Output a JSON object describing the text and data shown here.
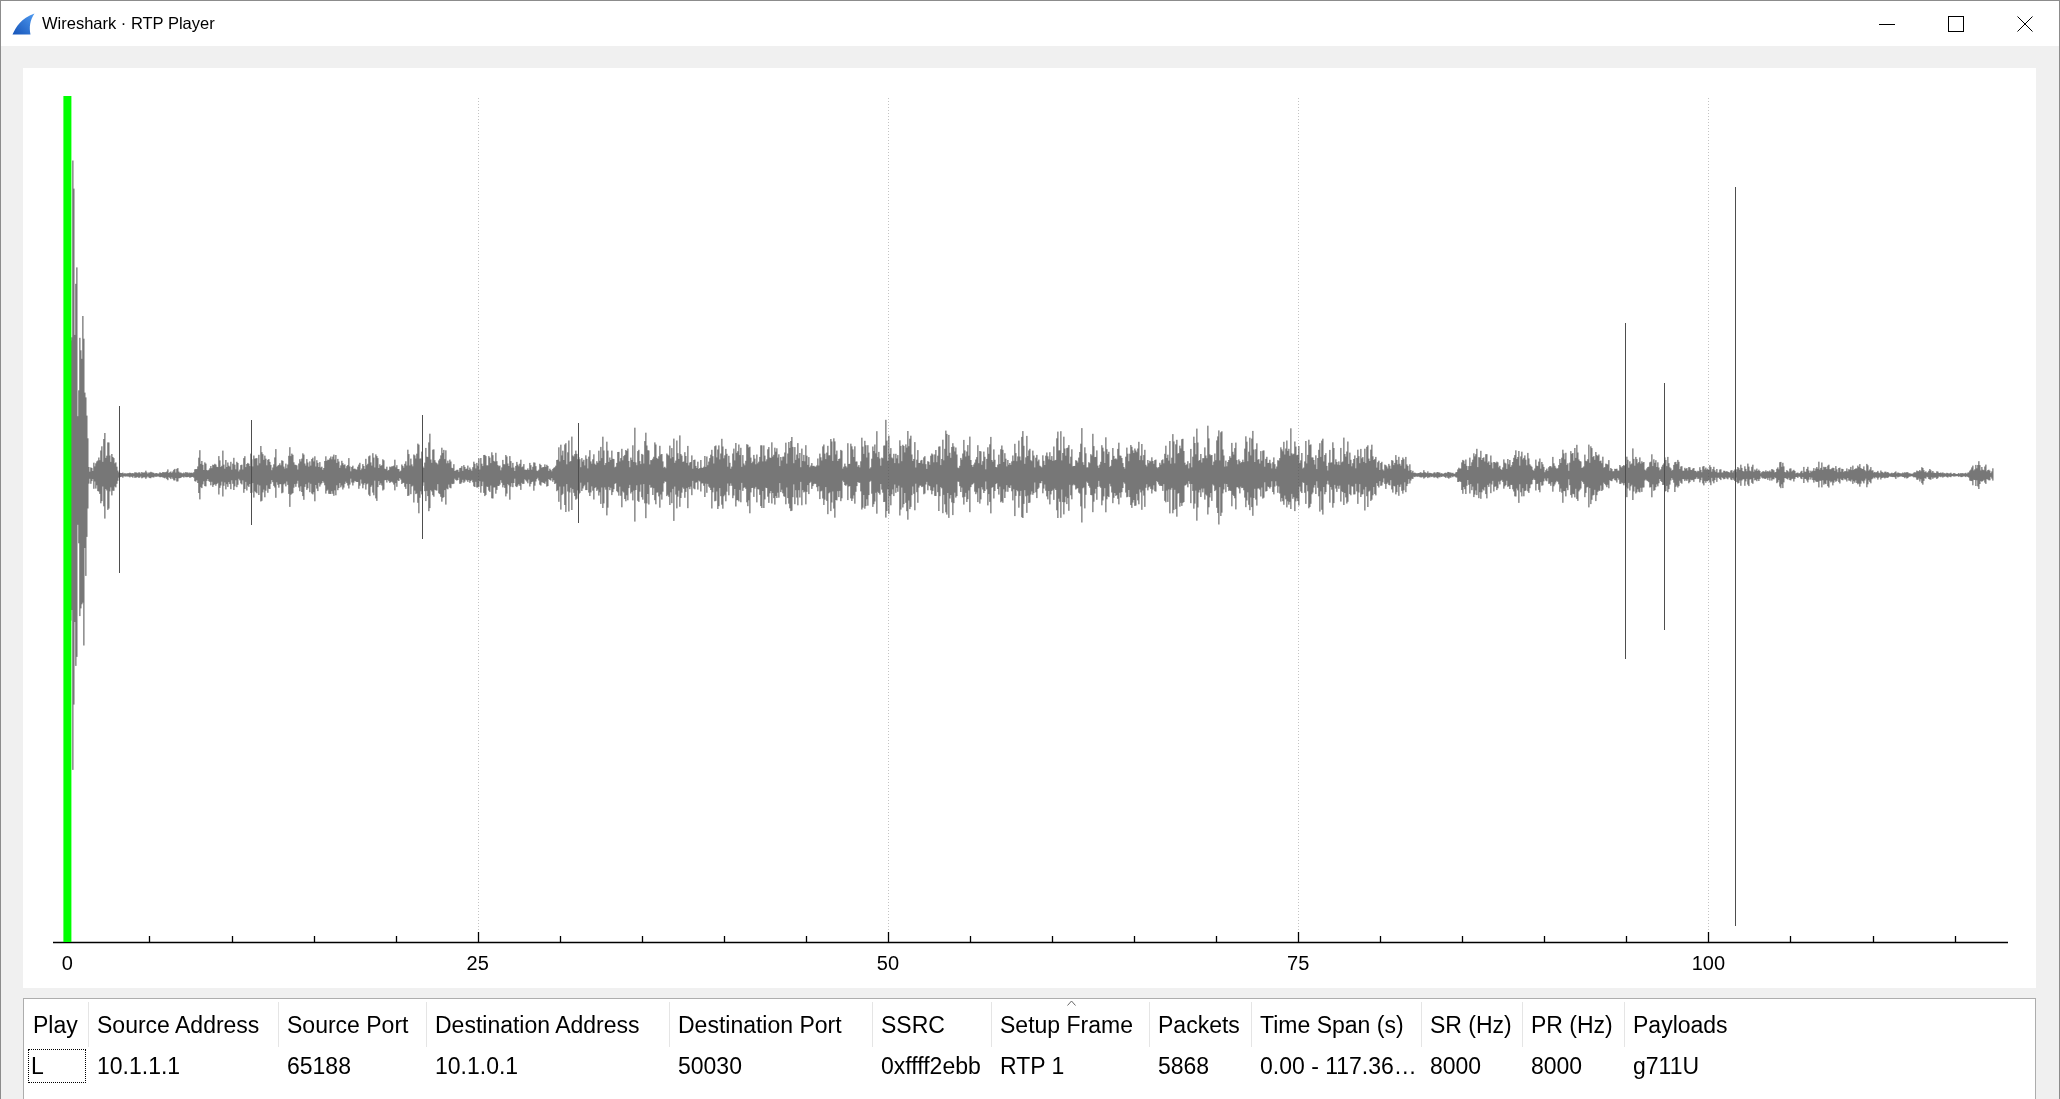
{
  "window": {
    "title": "Wireshark · RTP Player"
  },
  "waveform": {
    "tick_labels": [
      "0",
      "25",
      "50",
      "75",
      "100"
    ],
    "playhead": {
      "level": 0
    }
  },
  "table": {
    "columns": [
      {
        "label": "Play",
        "sorted": false
      },
      {
        "label": "Source Address",
        "sorted": false
      },
      {
        "label": "Source Port",
        "sorted": false
      },
      {
        "label": "Destination Address",
        "sorted": false
      },
      {
        "label": "Destination Port",
        "sorted": false
      },
      {
        "label": "SSRC",
        "sorted": false
      },
      {
        "label": "Setup Frame",
        "sorted": true
      },
      {
        "label": "Packets",
        "sorted": false
      },
      {
        "label": "Time Span (s)",
        "sorted": false
      },
      {
        "label": "SR (Hz)",
        "sorted": false
      },
      {
        "label": "PR (Hz)",
        "sorted": false
      },
      {
        "label": "Payloads",
        "sorted": false
      }
    ],
    "rows": [
      {
        "focused": true,
        "cells": [
          "L",
          "10.1.1.1",
          "65188",
          "10.1.0.1",
          "50030",
          "0xffff2ebb",
          "RTP 1",
          "5868",
          "0.00 - 117.36…",
          "8000",
          "8000",
          "g711U"
        ]
      }
    ]
  }
}
